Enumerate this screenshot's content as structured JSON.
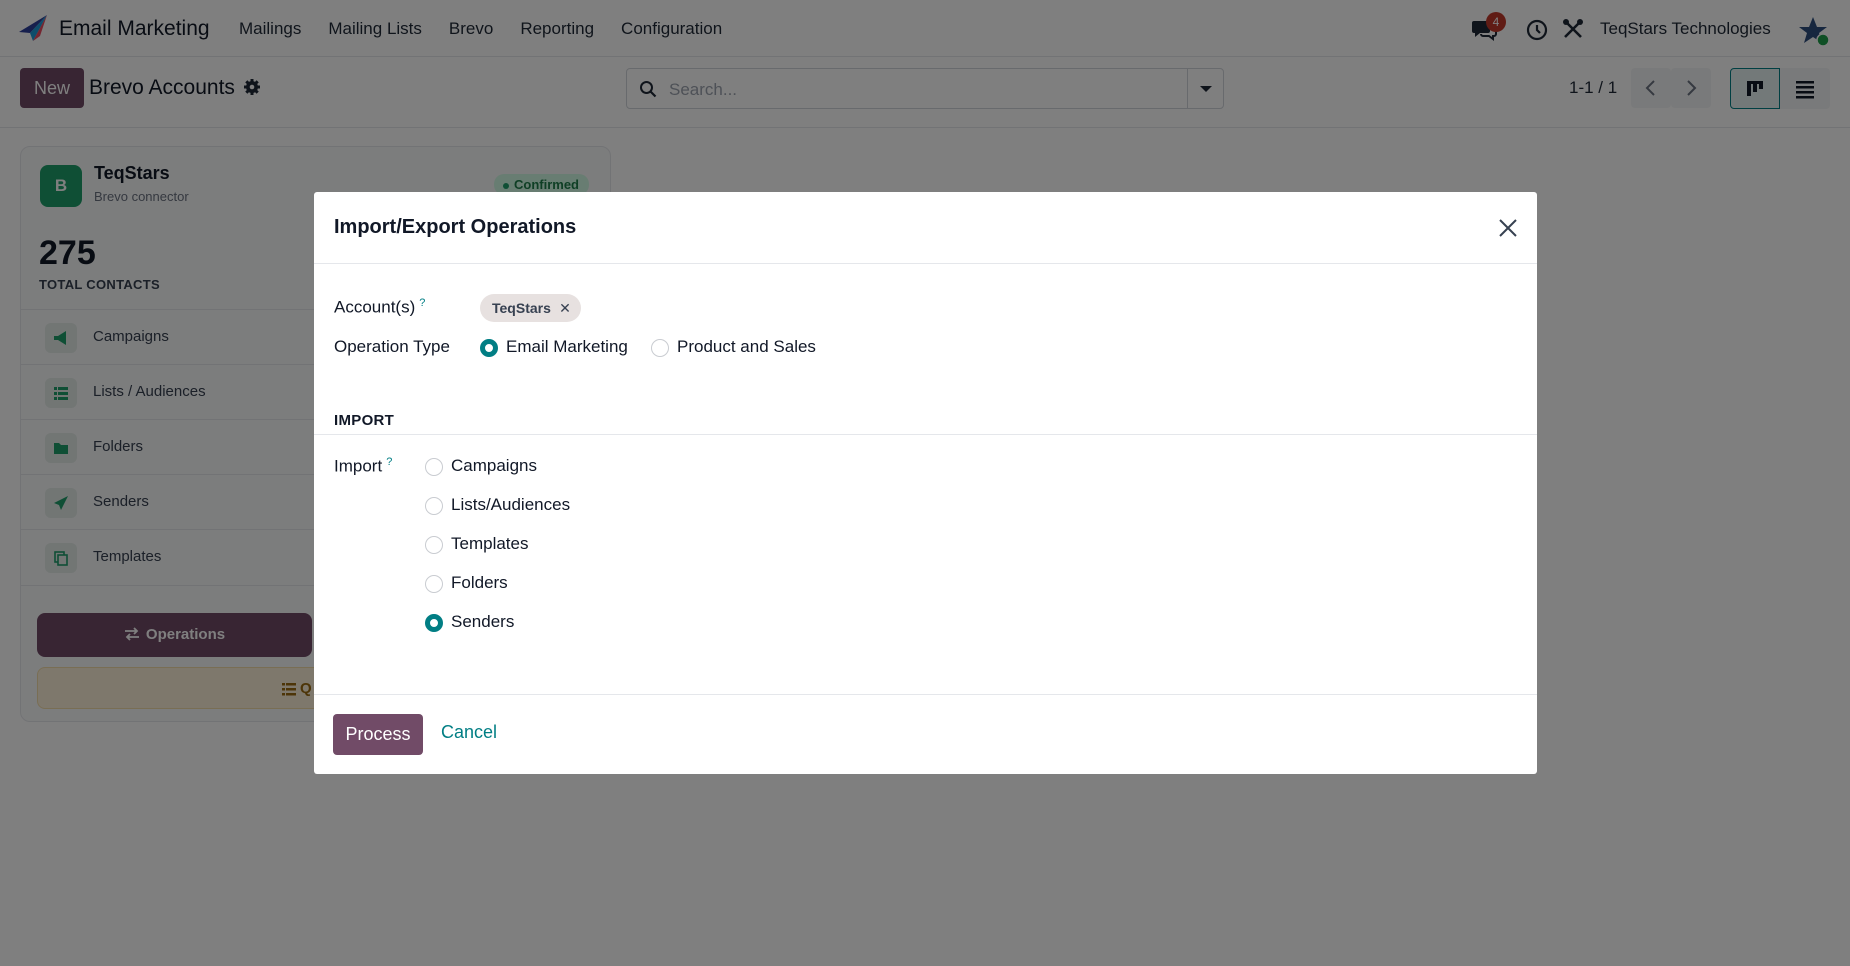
{
  "navbar": {
    "app_name": "Email Marketing",
    "menu": [
      "Mailings",
      "Mailing Lists",
      "Brevo",
      "Reporting",
      "Configuration"
    ],
    "notification_count": "4",
    "company": "TeqStars Technologies"
  },
  "control_panel": {
    "new_label": "New",
    "title": "Brevo Accounts",
    "search_placeholder": "Search...",
    "pager": "1-1 / 1"
  },
  "card": {
    "avatar_letter": "B",
    "name": "TeqStars",
    "subtitle": "Brevo connector",
    "status": "Confirmed",
    "count": "275",
    "count_label": "TOTAL CONTACTS",
    "items": [
      "Campaigns",
      "Lists / Audiences",
      "Folders",
      "Senders",
      "Templates"
    ],
    "operations_label": "Operations",
    "queue_label_partial": "Q"
  },
  "dialog": {
    "title": "Import/Export Operations",
    "accounts_label": "Account(s)",
    "accounts_help": "?",
    "account_tag": "TeqStars",
    "operation_type_label": "Operation Type",
    "operation_types": [
      {
        "label": "Email Marketing",
        "selected": true
      },
      {
        "label": "Product and Sales",
        "selected": false
      }
    ],
    "section_title": "IMPORT",
    "import_label": "Import",
    "import_help": "?",
    "import_options": [
      {
        "label": "Campaigns",
        "selected": false
      },
      {
        "label": "Lists/Audiences",
        "selected": false
      },
      {
        "label": "Templates",
        "selected": false
      },
      {
        "label": "Folders",
        "selected": false
      },
      {
        "label": "Senders",
        "selected": true
      }
    ],
    "process_label": "Process",
    "cancel_label": "Cancel"
  },
  "colors": {
    "brand": "#714b67",
    "accent": "#017e84",
    "badge": "#c0392b"
  }
}
